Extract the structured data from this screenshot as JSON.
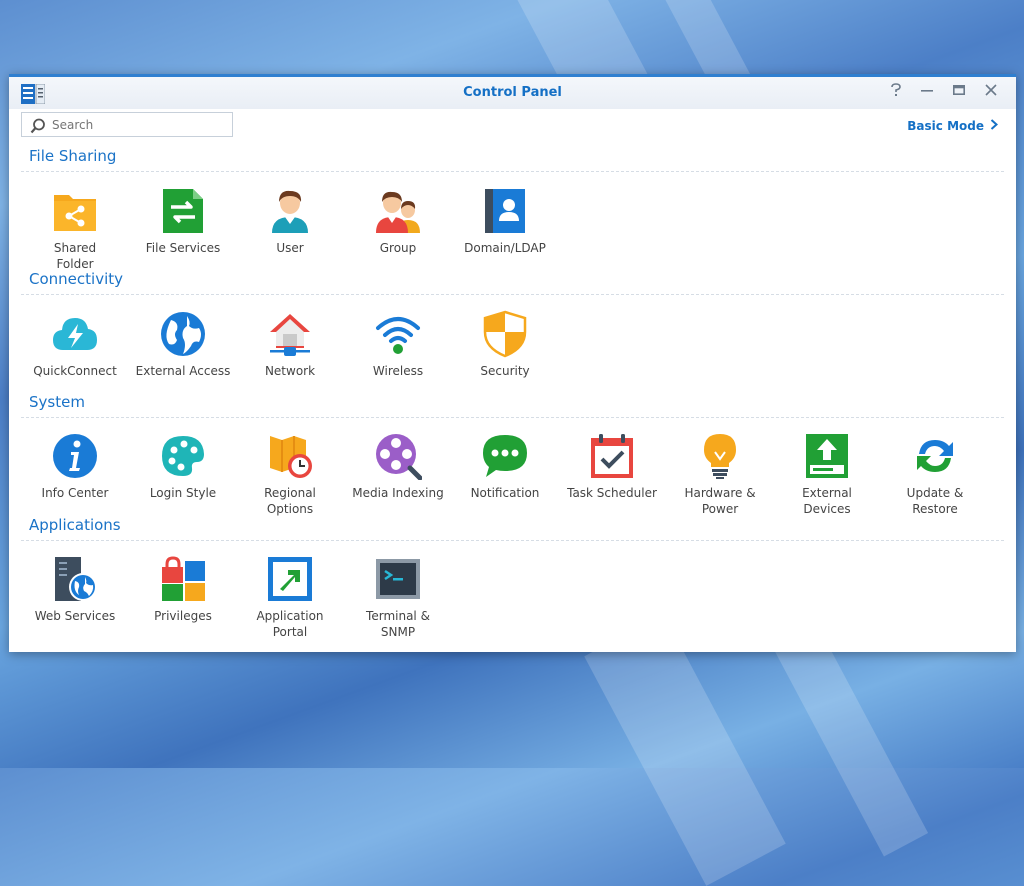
{
  "window": {
    "title": "Control Panel"
  },
  "search": {
    "placeholder": "Search"
  },
  "basic_mode": {
    "label": "Basic Mode"
  },
  "sections": [
    {
      "title": "File Sharing",
      "items": [
        {
          "label": "Shared\nFolder",
          "icon": "shared-folder-icon"
        },
        {
          "label": "File Services",
          "icon": "file-services-icon"
        },
        {
          "label": "User",
          "icon": "user-icon"
        },
        {
          "label": "Group",
          "icon": "group-icon"
        },
        {
          "label": "Domain/LDAP",
          "icon": "domain-ldap-icon"
        }
      ]
    },
    {
      "title": "Connectivity",
      "items": [
        {
          "label": "QuickConnect",
          "icon": "quickconnect-icon"
        },
        {
          "label": "External Access",
          "icon": "external-access-icon"
        },
        {
          "label": "Network",
          "icon": "network-icon"
        },
        {
          "label": "Wireless",
          "icon": "wireless-icon"
        },
        {
          "label": "Security",
          "icon": "security-icon"
        }
      ]
    },
    {
      "title": "System",
      "items": [
        {
          "label": "Info Center",
          "icon": "info-center-icon"
        },
        {
          "label": "Login Style",
          "icon": "login-style-icon"
        },
        {
          "label": "Regional\nOptions",
          "icon": "regional-options-icon"
        },
        {
          "label": "Media Indexing",
          "icon": "media-indexing-icon"
        },
        {
          "label": "Notification",
          "icon": "notification-icon"
        },
        {
          "label": "Task Scheduler",
          "icon": "task-scheduler-icon"
        },
        {
          "label": "Hardware &\nPower",
          "icon": "hardware-power-icon"
        },
        {
          "label": "External\nDevices",
          "icon": "external-devices-icon"
        },
        {
          "label": "Update &\nRestore",
          "icon": "update-restore-icon"
        }
      ]
    },
    {
      "title": "Applications",
      "items": [
        {
          "label": "Web Services",
          "icon": "web-services-icon"
        },
        {
          "label": "Privileges",
          "icon": "privileges-icon"
        },
        {
          "label": "Application\nPortal",
          "icon": "application-portal-icon"
        },
        {
          "label": "Terminal &\nSNMP",
          "icon": "terminal-snmp-icon"
        }
      ]
    }
  ],
  "colors": {
    "accent": "#1570c5",
    "title_bar": "#2f7fd0"
  }
}
